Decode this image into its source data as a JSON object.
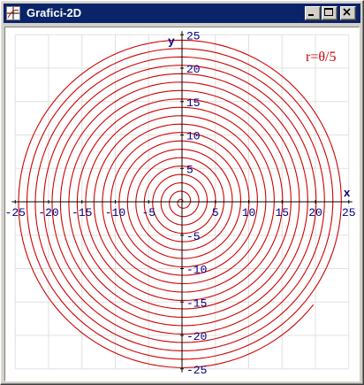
{
  "window": {
    "title": "Grafici-2D"
  },
  "titlebar": {
    "icon": "crosshair-icon",
    "buttons": [
      "minimize-icon",
      "maximize-icon",
      "close-icon"
    ]
  },
  "colors": {
    "titlebar": "#0a246a",
    "curve": "#d00000",
    "axis_labels": "#000080",
    "grid": "#e0e0e0"
  },
  "chart_data": {
    "type": "line",
    "title": "",
    "annotation": "r=θ/5",
    "xlabel": "x",
    "ylabel": "y",
    "xlim": [
      -25,
      25
    ],
    "ylim": [
      -25,
      25
    ],
    "x_ticks": [
      "-25",
      "-20",
      "-15",
      "-10",
      "-5",
      "5",
      "10",
      "15",
      "20",
      "25"
    ],
    "y_ticks": [
      "25",
      "20",
      "15",
      "10",
      "5",
      "-5",
      "-10",
      "-15",
      "-20",
      "-25"
    ],
    "grid": true,
    "series": [
      {
        "kind": "polar",
        "equation": "r = θ/5",
        "theta_range": [
          0,
          125
        ]
      }
    ]
  }
}
